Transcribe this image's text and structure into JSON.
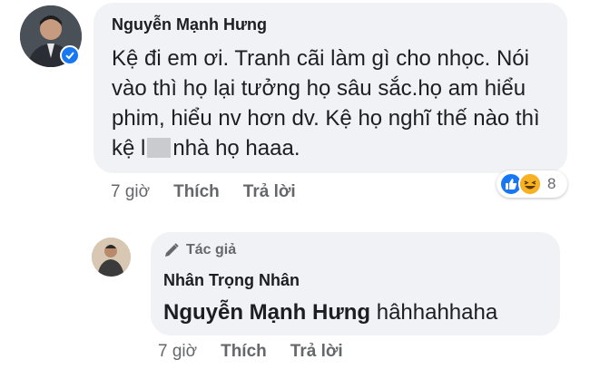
{
  "comment": {
    "author": "Nguyễn Mạnh Hưng",
    "text_before_censor": "Kệ đi em ơi. Tranh cãi làm gì cho nhọc. Nói vào thì họ lại tưởng họ sâu sắc.họ am hiểu phim, hiểu nv hơn dv. Kệ họ nghĩ thế nào thì kệ l",
    "text_after_censor": "nhà họ haaa.",
    "time": "7 giờ",
    "like_label": "Thích",
    "reply_label": "Trả lời",
    "reactions": {
      "icons": [
        "like-icon",
        "haha-icon"
      ],
      "count": "8"
    },
    "colors": {
      "like": "#1877f2",
      "haha": "#f7b125",
      "verified": "#1877f2"
    }
  },
  "reply": {
    "badge": "Tác giả",
    "author": "Nhân Trọng Nhân",
    "mention": "Nguyễn Mạnh Hưng",
    "text": "hâhhahhaha",
    "time": "7 giờ",
    "like_label": "Thích",
    "reply_label": "Trả lời"
  }
}
